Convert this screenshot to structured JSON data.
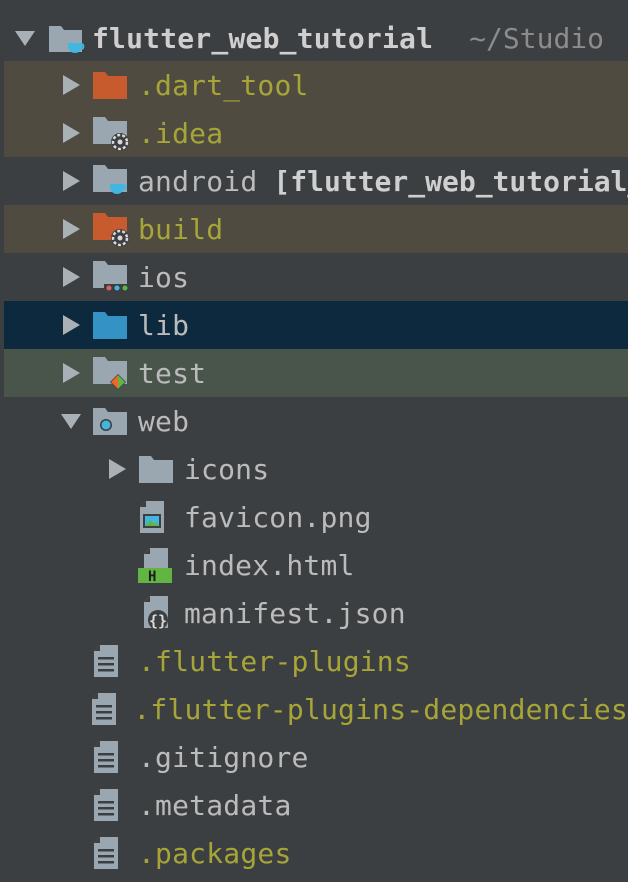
{
  "tree": {
    "root": {
      "label": "flutter_web_tutorial",
      "path": "~/Studio"
    },
    "items": [
      {
        "label": ".dart_tool",
        "type": "folder-orange",
        "depth": 1,
        "expanded": false,
        "style": "yellow",
        "bg": "ignored"
      },
      {
        "label": ".idea",
        "type": "folder-gear",
        "depth": 1,
        "expanded": false,
        "style": "yellow",
        "bg": "ignored"
      },
      {
        "label": "android",
        "module": "[flutter_web_tutorial_android]",
        "type": "folder-cup",
        "depth": 1,
        "expanded": false,
        "style": "normal",
        "bg": ""
      },
      {
        "label": "build",
        "type": "folder-orange-gear",
        "depth": 1,
        "expanded": false,
        "style": "yellow",
        "bg": "ignored"
      },
      {
        "label": "ios",
        "type": "folder-ios",
        "depth": 1,
        "expanded": false,
        "style": "normal",
        "bg": ""
      },
      {
        "label": "lib",
        "type": "folder-blue",
        "depth": 1,
        "expanded": false,
        "style": "normal",
        "bg": "selected"
      },
      {
        "label": "test",
        "type": "folder-test",
        "depth": 1,
        "expanded": false,
        "style": "normal",
        "bg": "test"
      },
      {
        "label": "web",
        "type": "folder-web",
        "depth": 1,
        "expanded": true,
        "style": "normal",
        "bg": ""
      },
      {
        "label": "icons",
        "type": "folder",
        "depth": 2,
        "expanded": false,
        "style": "normal",
        "bg": ""
      },
      {
        "label": "favicon.png",
        "type": "file-image",
        "depth": 2,
        "style": "normal",
        "bg": ""
      },
      {
        "label": "index.html",
        "type": "file-html",
        "depth": 2,
        "style": "normal",
        "bg": ""
      },
      {
        "label": "manifest.json",
        "type": "file-json",
        "depth": 2,
        "style": "normal",
        "bg": ""
      },
      {
        "label": ".flutter-plugins",
        "type": "file-text",
        "depth": 1,
        "style": "yellow",
        "bg": ""
      },
      {
        "label": ".flutter-plugins-dependencies",
        "type": "file-text",
        "depth": 1,
        "style": "yellow",
        "bg": ""
      },
      {
        "label": ".gitignore",
        "type": "file-text",
        "depth": 1,
        "style": "normal",
        "bg": ""
      },
      {
        "label": ".metadata",
        "type": "file-text",
        "depth": 1,
        "style": "normal",
        "bg": ""
      },
      {
        "label": ".packages",
        "type": "file-text",
        "depth": 1,
        "style": "yellow",
        "bg": ""
      }
    ]
  },
  "colors": {
    "panel_bg": "#3c3f41",
    "ignored_bg": "#4f4b41",
    "selected_bg": "#0d293e",
    "test_bg": "#49544a",
    "ignored_text": "#a7a537",
    "folder_gray": "#9aa7b0",
    "folder_orange": "#c75b2e",
    "folder_blue": "#3592c4"
  }
}
